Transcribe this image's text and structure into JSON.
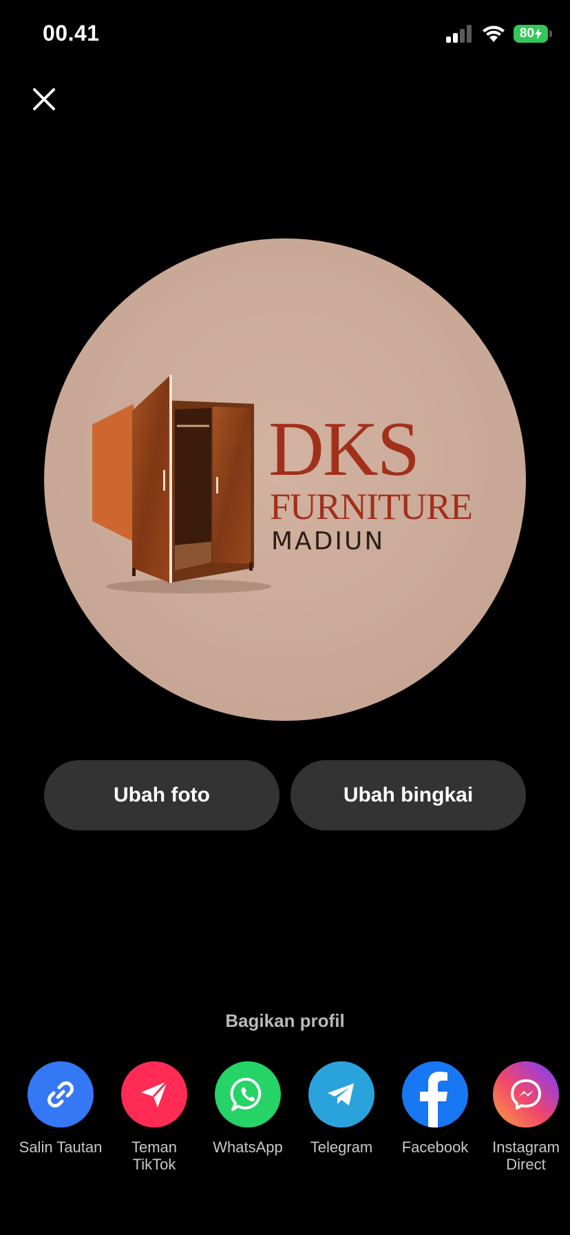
{
  "status_bar": {
    "time": "00.41",
    "battery": "80"
  },
  "profile_logo": {
    "brand": "DKS",
    "line2": "FURNITURE",
    "line3": "MADIUN"
  },
  "buttons": {
    "change_photo": "Ubah foto",
    "change_frame": "Ubah bingkai"
  },
  "share": {
    "title": "Bagikan profil",
    "options": [
      {
        "label": "Salin Tautan",
        "icon": "link-icon",
        "color": "#3478f6"
      },
      {
        "label": "Teman TikTok",
        "icon": "send-icon",
        "color": "#fe2c55"
      },
      {
        "label": "WhatsApp",
        "icon": "whatsapp-icon",
        "color": "#25d366"
      },
      {
        "label": "Telegram",
        "icon": "telegram-icon",
        "color": "#2aa3dd"
      },
      {
        "label": "Facebook",
        "icon": "facebook-icon",
        "color": "#1877f2"
      },
      {
        "label": "Instagram Direct",
        "icon": "messenger-icon",
        "color": "#c13584"
      }
    ]
  }
}
